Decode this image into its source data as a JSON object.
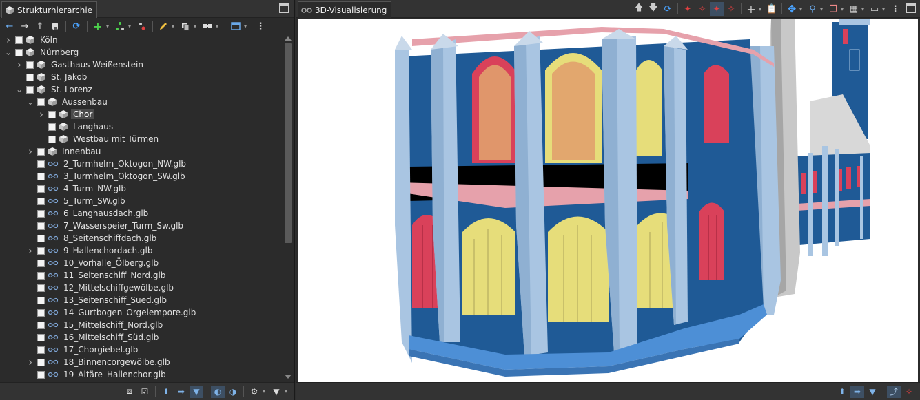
{
  "left_panel": {
    "tab_title": "Strukturhierarchie",
    "tree": [
      {
        "depth": 0,
        "expander": "right",
        "kind": "cube",
        "label": "Köln"
      },
      {
        "depth": 0,
        "expander": "down",
        "kind": "cube",
        "label": "Nürnberg"
      },
      {
        "depth": 1,
        "expander": "right",
        "kind": "cube",
        "label": "Gasthaus Weißenstein"
      },
      {
        "depth": 1,
        "expander": "none",
        "kind": "cube",
        "label": "St. Jakob"
      },
      {
        "depth": 1,
        "expander": "down",
        "kind": "cube",
        "label": "St. Lorenz"
      },
      {
        "depth": 2,
        "expander": "down",
        "kind": "cube",
        "label": "Aussenbau"
      },
      {
        "depth": 3,
        "expander": "right",
        "kind": "cube",
        "label": "Chor",
        "selected": true
      },
      {
        "depth": 3,
        "expander": "none",
        "kind": "cube",
        "label": "Langhaus"
      },
      {
        "depth": 3,
        "expander": "none",
        "kind": "cube",
        "label": "Westbau mit Türmen"
      },
      {
        "depth": 2,
        "expander": "right",
        "kind": "cube",
        "label": "Innenbau"
      },
      {
        "depth": 2,
        "expander": "none",
        "kind": "glb",
        "label": "2_Turmhelm_Oktogon_NW.glb"
      },
      {
        "depth": 2,
        "expander": "none",
        "kind": "glb",
        "label": "3_Turmhelm_Oktogon_SW.glb"
      },
      {
        "depth": 2,
        "expander": "none",
        "kind": "glb",
        "label": "4_Turm_NW.glb"
      },
      {
        "depth": 2,
        "expander": "none",
        "kind": "glb",
        "label": "5_Turm_SW.glb"
      },
      {
        "depth": 2,
        "expander": "none",
        "kind": "glb",
        "label": "6_Langhausdach.glb"
      },
      {
        "depth": 2,
        "expander": "none",
        "kind": "glb",
        "label": "7_Wasserspeier_Turm_Sw.glb"
      },
      {
        "depth": 2,
        "expander": "none",
        "kind": "glb",
        "label": "8_Seitenschiffdach.glb"
      },
      {
        "depth": 2,
        "expander": "right",
        "kind": "glb",
        "label": "9_Hallenchordach.glb"
      },
      {
        "depth": 2,
        "expander": "none",
        "kind": "glb",
        "label": "10_Vorhalle_Ölberg.glb"
      },
      {
        "depth": 2,
        "expander": "none",
        "kind": "glb",
        "label": "11_Seitenschiff_Nord.glb"
      },
      {
        "depth": 2,
        "expander": "none",
        "kind": "glb",
        "label": "12_Mittelschiffgewölbe.glb"
      },
      {
        "depth": 2,
        "expander": "none",
        "kind": "glb",
        "label": "13_Seitenschiff_Sued.glb"
      },
      {
        "depth": 2,
        "expander": "none",
        "kind": "glb",
        "label": "14_Gurtbogen_Orgelempore.glb"
      },
      {
        "depth": 2,
        "expander": "none",
        "kind": "glb",
        "label": "15_Mittelschiff_Nord.glb"
      },
      {
        "depth": 2,
        "expander": "none",
        "kind": "glb",
        "label": "16_Mittelschiff_Süd.glb"
      },
      {
        "depth": 2,
        "expander": "none",
        "kind": "glb",
        "label": "17_Chorgiebel.glb"
      },
      {
        "depth": 2,
        "expander": "right",
        "kind": "glb",
        "label": "18_Binnencorgewölbe.glb"
      },
      {
        "depth": 2,
        "expander": "none",
        "kind": "glb",
        "label": "19_Altäre_Hallenchor.glb"
      }
    ]
  },
  "right_panel": {
    "tab_title": "3D-Visualisierung"
  },
  "colors": {
    "wall_blue": "#1f5a96",
    "pillar_light": "#a9c5e2",
    "window_yellow": "#e6dd7a",
    "window_red": "#d9415a",
    "cornice_pink": "#e6a1ab",
    "base_blue": "#4d8fd6",
    "stone_grey": "#c8c8c8",
    "accent_icon": "#6aa8e8"
  }
}
